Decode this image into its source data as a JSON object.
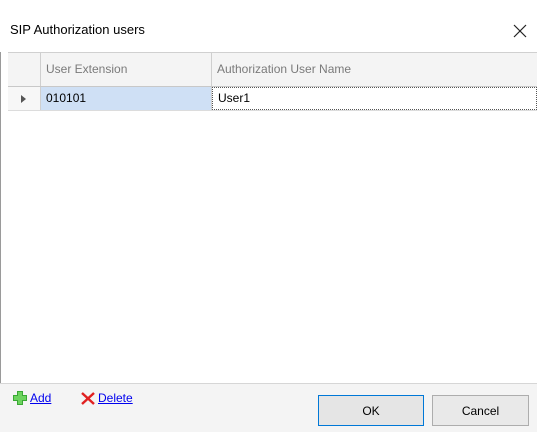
{
  "window": {
    "title": "SIP Authorization users",
    "close_icon": "close-icon"
  },
  "grid": {
    "columns": [
      "User Extension",
      "Authorization User Name"
    ],
    "rows": [
      {
        "extension": "010101",
        "auth_user_name": "User1",
        "selected": true
      }
    ]
  },
  "footer": {
    "add_label": "Add",
    "delete_label": "Delete",
    "ok_label": "OK",
    "cancel_label": "Cancel"
  },
  "colors": {
    "selected_cell": "#cfe0f5",
    "link": "#0000ee",
    "add_icon": "#3aa835",
    "delete_icon": "#e02020",
    "focus_border": "#0078d7"
  }
}
